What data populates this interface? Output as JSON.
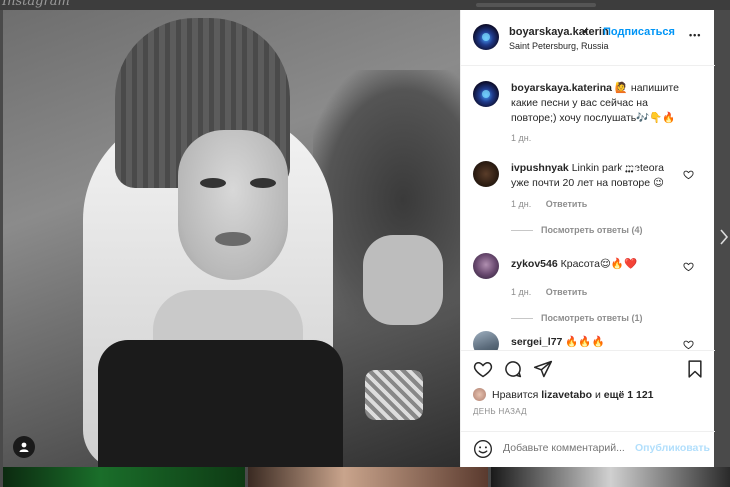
{
  "header": {
    "username": "boyarskaya.katerin",
    "separator": "•",
    "follow_label": "Подписаться",
    "location": "Saint Petersburg, Russia",
    "more_label": "•••"
  },
  "caption": {
    "username": "boyarskaya.katerina",
    "text": "🙋 напишите какие песни у вас сейчас на повторе;) хочу послушать🎶👇🔥",
    "time": "1 дн."
  },
  "comments": [
    {
      "username": "ivpushnyak",
      "text": "Linkin park meteora уже почти 20 лет на повторе 😉",
      "time": "1 дн.",
      "reply_label": "Ответить",
      "view_replies": "Посмотреть ответы (4)",
      "more_label": "•••"
    },
    {
      "username": "zykov546",
      "text": "Красота😌🔥❤️",
      "time": "1 дн.",
      "reply_label": "Ответить",
      "view_replies": "Посмотреть ответы (1)"
    },
    {
      "username": "sergei_l77",
      "text": "🔥🔥🔥"
    }
  ],
  "likes": {
    "prefix": "Нравится",
    "user": "lizavetabo",
    "middle": "и",
    "rest": "ещё 1 121"
  },
  "post_date": "ДЕНЬ НАЗАД",
  "add_comment": {
    "placeholder": "Добавьте комментарий...",
    "post_label": "Опубликовать"
  },
  "icons": {
    "like": "heart-icon",
    "comment": "comment-icon",
    "share": "share-icon",
    "save": "bookmark-icon",
    "emoji": "smile-icon",
    "next": "chevron-right-icon",
    "user_tag": "user-tag-icon"
  },
  "colors": {
    "accent": "#0095f6",
    "text": "#262626",
    "muted": "#8e8e8e"
  }
}
